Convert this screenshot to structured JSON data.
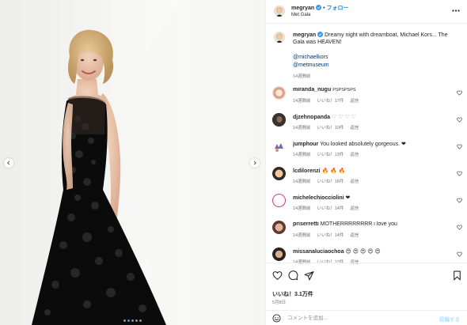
{
  "header": {
    "username": "megryan",
    "follow_label": "フォロー",
    "location": "Met Gala"
  },
  "caption": {
    "username": "megryan",
    "text": "Dreamy night with dreamboat, Michael Kors... The Gala was HEAVEN!",
    "mention1": "@michaelkors",
    "mention2": "@metmuseum",
    "time": "14週間前"
  },
  "comments": [
    {
      "user": "miranda_nugu",
      "text": "PSPSPSPS",
      "time": "14週間前",
      "likes": "いいね！17件",
      "reply": "返信"
    },
    {
      "user": "djzehnopanda",
      "text": "♡ ♡ ♡ ♡",
      "time": "14週間前",
      "likes": "いいね！10件",
      "reply": "返信"
    },
    {
      "user": "jumphour",
      "text": "You looked absolutely gorgeous. ❤",
      "time": "14週間前",
      "likes": "いいね！13件",
      "reply": "返信"
    },
    {
      "user": "lcdilorenzi",
      "text": "🔥 🔥 🔥",
      "time": "14週間前",
      "likes": "いいね！16件",
      "reply": "返信"
    },
    {
      "user": "michelechiocciolini",
      "text": "❤",
      "time": "14週間前",
      "likes": "いいね！14件",
      "reply": "返信"
    },
    {
      "user": "priserretti",
      "text": "MOTHERRRRRRRR i love you",
      "time": "14週間前",
      "likes": "いいね！14件",
      "reply": "返信"
    },
    {
      "user": "missanaluciaochoa",
      "text": "😍 😍 😍 😍 😍",
      "time": "14週間前",
      "likes": "いいね！12件",
      "reply": "返信"
    }
  ],
  "actions": {
    "likes": "いいね！3.1万件",
    "date": "5月8日"
  },
  "composer": {
    "placeholder": "コメントを追加...",
    "post_label": "投稿する"
  },
  "icons": {
    "verified": "verified-badge-icon",
    "like": "heart-icon",
    "comment": "comment-icon",
    "share": "share-icon",
    "save": "bookmark-icon",
    "emoji": "emoji-icon",
    "more": "more-icon"
  },
  "colors": {
    "accent": "#0095f6",
    "verified": "#3897f0",
    "mention": "#00376b",
    "muted": "#737373"
  }
}
